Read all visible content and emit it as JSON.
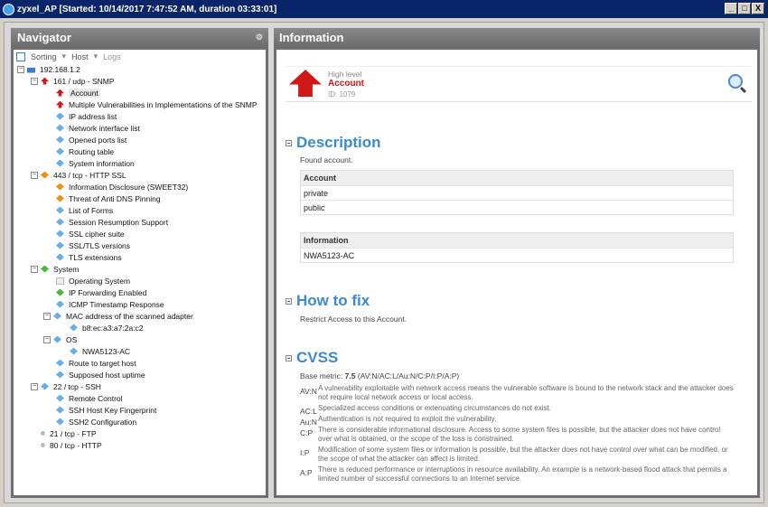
{
  "window": {
    "title": "zyxel_AP [Started: 10/14/2017 7:47:52 AM, duration 03:33:01]",
    "buttons": [
      "_",
      "□",
      "X"
    ]
  },
  "navigator": {
    "title": "Navigator",
    "toolbar": {
      "sorting": "Sorting",
      "host": "Host",
      "logs": "Logs"
    },
    "tree": [
      {
        "label": "192.168.1.2"
      },
      {
        "label": "161 / udp - SNMP"
      },
      {
        "label": "Account"
      },
      {
        "label": "Multiple Vulnerabilities in Implementations of the SNMP"
      },
      {
        "label": "IP address list"
      },
      {
        "label": "Network interface list"
      },
      {
        "label": "Opened ports list"
      },
      {
        "label": "Routing table"
      },
      {
        "label": "System information"
      },
      {
        "label": "443 / tcp - HTTP SSL"
      },
      {
        "label": "Information Disclosure (SWEET32)"
      },
      {
        "label": "Threat of Anti DNS Pinning"
      },
      {
        "label": "List of Forms"
      },
      {
        "label": "Session Resumption Support"
      },
      {
        "label": "SSL cipher suite"
      },
      {
        "label": "SSL/TLS versions"
      },
      {
        "label": "TLS extensions"
      },
      {
        "label": "System"
      },
      {
        "label": "Operating System"
      },
      {
        "label": "IP Forwarding Enabled"
      },
      {
        "label": "ICMP Timestamp Response"
      },
      {
        "label": "MAC address of the scanned adapter"
      },
      {
        "label": "b8:ec:a3:a7:2a:c2"
      },
      {
        "label": "OS"
      },
      {
        "label": "NWA5123-AC"
      },
      {
        "label": "Route to target host"
      },
      {
        "label": "Supposed host uptime"
      },
      {
        "label": "22 / tcp - SSH"
      },
      {
        "label": "Remote Control"
      },
      {
        "label": "SSH Host Key Fingerprint"
      },
      {
        "label": "SSH2 Configuration"
      },
      {
        "label": "21 / tcp - FTP"
      },
      {
        "label": "80 / tcp - HTTP"
      }
    ]
  },
  "information": {
    "title": "Information",
    "level": "High level",
    "name": "Account",
    "id": "ID: 1079",
    "description": {
      "heading": "Description",
      "text": "Found account.",
      "account_header": "Account",
      "accounts": [
        "private",
        "public"
      ],
      "info_header": "Information",
      "info_value": "NWA5123-AC"
    },
    "how_to_fix": {
      "heading": "How to fix",
      "text": "Restrict Access to this Account."
    },
    "cvss": {
      "heading": "CVSS",
      "base_label": "Base metric:",
      "base_score": "7.5",
      "vector": "(AV:N/AC:L/Au:N/C:P/I:P/A:P)",
      "rows": [
        {
          "key": "AV:N",
          "text": "A vulnerability exploitable with network access means the vulnerable software is bound to the network stack and the attacker does not require local network access or local access."
        },
        {
          "key": "AC:L",
          "text": "Specialized access conditions or extenuating circumstances do not exist."
        },
        {
          "key": "Au:N",
          "text": "Authentication is not required to exploit the vulnerability."
        },
        {
          "key": "C:P",
          "text": "There is considerable informational disclosure. Access to some system files is possible, but the attacker does not have control over what is obtained, or the scope of the loss is constrained."
        },
        {
          "key": "I:P",
          "text": "Modification of some system files or information is possible, but the attacker does not have control over what can be modified, or the scope of what the attacker can affect is limited."
        },
        {
          "key": "A:P",
          "text": "There is reduced performance or interruptions in resource availability. An example is a network-based flood attack that permits a limited number of successful connections to an Internet service."
        }
      ]
    }
  },
  "colors": {
    "accent": "#3a8ad0",
    "danger": "#d01818",
    "titlebar": "#0a246a"
  }
}
